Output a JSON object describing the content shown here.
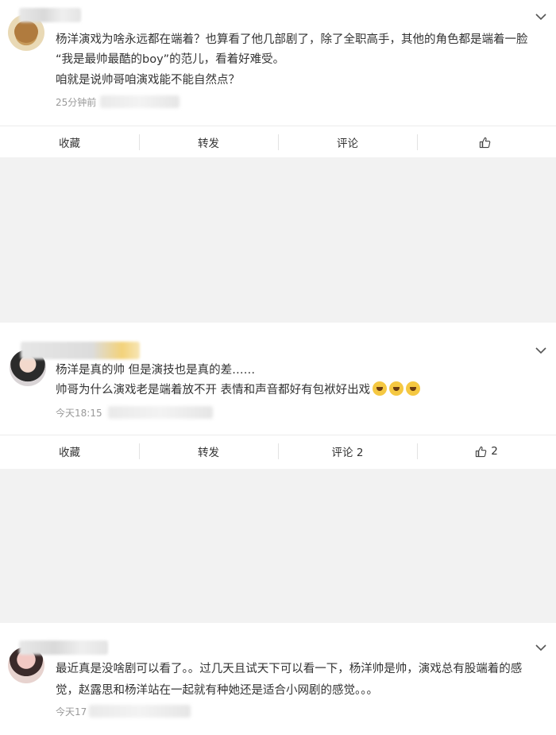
{
  "posts": [
    {
      "lines": [
        "杨洋演戏为啥永远都在端着？也算看了他几部剧了，除了全职高手，其他的角色都是端着一脸",
        "“我是最帅最酷的boy”的范儿，看着好难受。",
        "咱就是说帅哥咱演戏能不能自然点？"
      ],
      "time": "25分钟前",
      "actions": {
        "favorite": "收藏",
        "repost": "转发",
        "comment": "评论",
        "like": ""
      }
    },
    {
      "lines": [
        "杨洋是真的帅 但是演技也是真的差……",
        "帅哥为什么演戏老是端着放不开 表情和声音都好有包袱好出戏"
      ],
      "time": "今天18:15",
      "actions": {
        "favorite": "收藏",
        "repost": "转发",
        "comment": "评论 2",
        "like": "2"
      }
    },
    {
      "lines": [
        "最近真是没啥剧可以看了。。过几天且试天下可以看一下，杨洋帅是帅，演戏总有股端着的感",
        "觉，赵露思和杨洋站在一起就有种她还是适合小网剧的感觉。。。"
      ],
      "time": "今天17"
    }
  ]
}
